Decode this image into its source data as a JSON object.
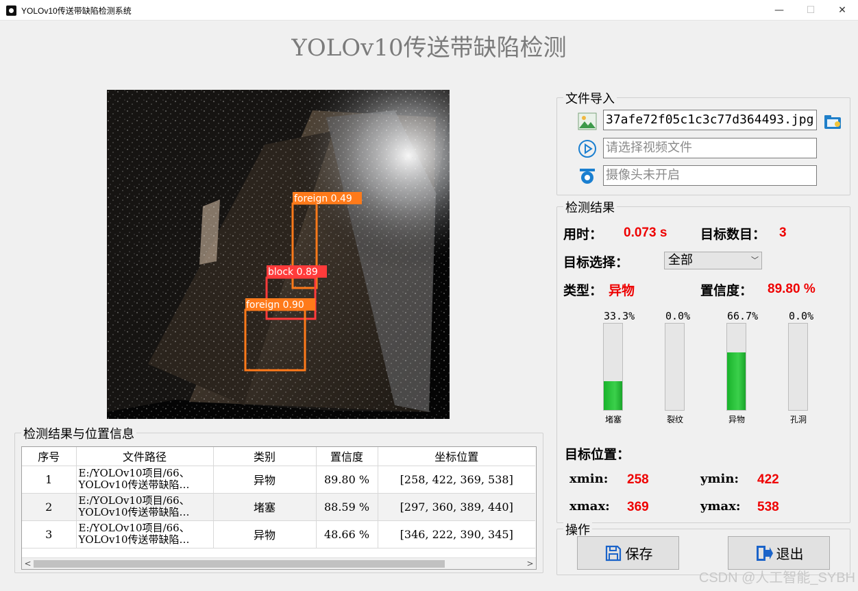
{
  "window": {
    "title": "YOLOv10传送带缺陷检测系统",
    "minimize": "—",
    "maximize": "☐",
    "close": "✕"
  },
  "main_title": "YOLOv10传送带缺陷检测",
  "image": {
    "detections": [
      {
        "label": "foreign 0.49",
        "color": "#ff7a1a"
      },
      {
        "label": "block 0.89",
        "color": "#ff3b3b"
      },
      {
        "label": "foreign 0.90",
        "color": "#ff7a1a"
      }
    ]
  },
  "results_table": {
    "group_title": "检测结果与位置信息",
    "columns": [
      "序号",
      "文件路径",
      "类别",
      "置信度",
      "坐标位置"
    ],
    "rows": [
      {
        "index": "1",
        "path_line1": "E:/YOLOv10项目/66、",
        "path_line2": "YOLOv10传送带缺陷…",
        "category": "异物",
        "confidence": "89.80 %",
        "coords": "[258, 422, 369, 538]"
      },
      {
        "index": "2",
        "path_line1": "E:/YOLOv10项目/66、",
        "path_line2": "YOLOv10传送带缺陷…",
        "category": "堵塞",
        "confidence": "88.59 %",
        "coords": "[297, 360, 389, 440]"
      },
      {
        "index": "3",
        "path_line1": "E:/YOLOv10项目/66、",
        "path_line2": "YOLOv10传送带缺陷…",
        "category": "异物",
        "confidence": "48.66 %",
        "coords": "[346, 222, 390, 345]"
      }
    ],
    "scroll_left": "<",
    "scroll_right": ">"
  },
  "file_import": {
    "group_title": "文件导入",
    "image_file_value": "37afe72f05c1c3c77d364493.jpg",
    "video_placeholder": "请选择视频文件",
    "camera_placeholder": "摄像头未开启"
  },
  "detection_results": {
    "group_title": "检测结果",
    "time_label": "用时：",
    "time_value": "0.073 s",
    "count_label": "目标数目：",
    "count_value": "3",
    "select_label": "目标选择：",
    "select_value": "全部",
    "type_label": "类型：",
    "type_value": "异物",
    "conf_label": "置信度：",
    "conf_value": "89.80 %",
    "bars": [
      {
        "pct_text": "33.3%",
        "fraction": 0.333,
        "label": "堵塞"
      },
      {
        "pct_text": "0.0%",
        "fraction": 0.0,
        "label": "裂纹"
      },
      {
        "pct_text": "66.7%",
        "fraction": 0.667,
        "label": "异物"
      },
      {
        "pct_text": "0.0%",
        "fraction": 0.0,
        "label": "孔洞"
      }
    ],
    "position_label": "目标位置：",
    "xmin_label": "xmin:",
    "xmin_value": "258",
    "ymin_label": "ymin:",
    "ymin_value": "422",
    "xmax_label": "xmax:",
    "xmax_value": "369",
    "ymax_label": "ymax:",
    "ymax_value": "538"
  },
  "operations": {
    "group_title": "操作",
    "save_label": "保存",
    "exit_label": "退出"
  },
  "watermark": "CSDN @人工智能_SYBH",
  "colors": {
    "accent_red": "#ee0000",
    "bar_green": "#19b32b"
  }
}
